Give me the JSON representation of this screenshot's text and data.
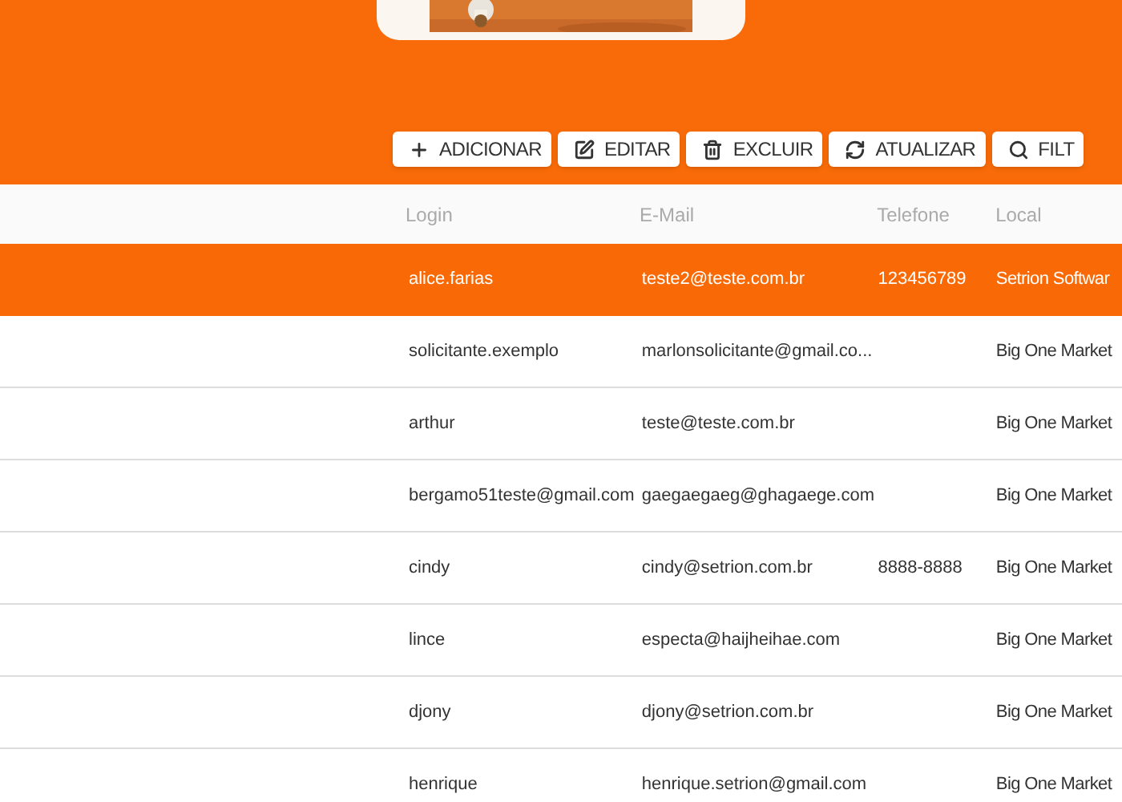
{
  "toolbar": {
    "buttons": [
      {
        "label": "ADICIONAR",
        "kind": "plus"
      },
      {
        "label": "EDITAR",
        "kind": "edit"
      },
      {
        "label": "EXCLUIR",
        "kind": "trash"
      },
      {
        "label": "ATUALIZAR",
        "kind": "refresh"
      },
      {
        "label": "FILT",
        "kind": "search"
      }
    ]
  },
  "table": {
    "columns": [
      "Login",
      "E-Mail",
      "Telefone",
      "Local"
    ],
    "rows": [
      {
        "selected": true,
        "cells": [
          "alice.farias",
          "teste2@teste.com.br",
          "123456789",
          "Setrion Softwar"
        ]
      },
      {
        "selected": false,
        "cells": [
          "solicitante.exemplo",
          "marlonsolicitante@gmail.co...",
          "",
          "Big One Market"
        ]
      },
      {
        "selected": false,
        "cells": [
          "arthur",
          "teste@teste.com.br",
          "",
          "Big One Market"
        ]
      },
      {
        "selected": false,
        "cells": [
          "bergamo51teste@gmail.com",
          "gaegaegaeg@ghagaege.com",
          "",
          "Big One Market"
        ]
      },
      {
        "selected": false,
        "cells": [
          "cindy",
          "cindy@setrion.com.br",
          "8888-8888",
          "Big One Market"
        ]
      },
      {
        "selected": false,
        "cells": [
          "lince",
          "especta@haijheihae.com",
          "",
          "Big One Market"
        ]
      },
      {
        "selected": false,
        "cells": [
          "djony",
          "djony@setrion.com.br",
          "",
          "Big One Market"
        ]
      },
      {
        "selected": false,
        "cells": [
          "henrique",
          "henrique.setrion@gmail.com",
          "",
          "Big One Market"
        ]
      }
    ]
  }
}
